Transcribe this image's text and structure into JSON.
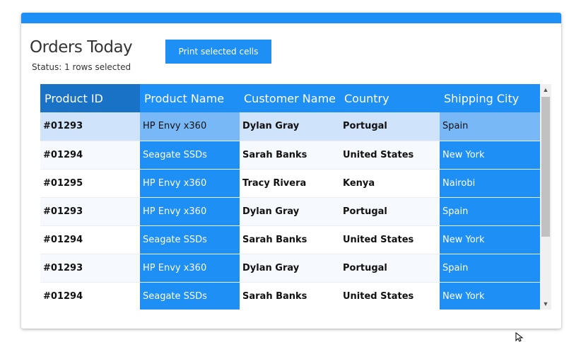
{
  "header": {
    "title": "Orders Today",
    "status": "Status: 1 rows selected",
    "print_label": "Print selected cells"
  },
  "grid": {
    "columns": [
      "Product ID",
      "Product Name",
      "Customer Name",
      "Country",
      "Shipping City"
    ],
    "rows": [
      {
        "id": "#01293",
        "product": "HP Envy x360",
        "customer": "Dylan Gray",
        "country": "Portugal",
        "city": "Spain"
      },
      {
        "id": "#01294",
        "product": "Seagate SSDs",
        "customer": "Sarah Banks",
        "country": "United States",
        "city": "New York"
      },
      {
        "id": "#01295",
        "product": "HP Envy x360",
        "customer": "Tracy Rivera",
        "country": "Kenya",
        "city": "Nairobi"
      },
      {
        "id": "#01293",
        "product": "HP Envy x360",
        "customer": "Dylan Gray",
        "country": "Portugal",
        "city": "Spain"
      },
      {
        "id": "#01294",
        "product": "Seagate SSDs",
        "customer": "Sarah Banks",
        "country": "United States",
        "city": "New York"
      },
      {
        "id": "#01293",
        "product": "HP Envy x360",
        "customer": "Dylan Gray",
        "country": "Portugal",
        "city": "Spain"
      },
      {
        "id": "#01294",
        "product": "Seagate SSDs",
        "customer": "Sarah Banks",
        "country": "United States",
        "city": "New York"
      }
    ],
    "selected_row": 0,
    "selected_columns": [
      "product",
      "city"
    ]
  },
  "icons": {
    "scroll_up": "chevron-up-icon",
    "scroll_down": "chevron-down-icon",
    "cursor": "mouse-cursor-icon"
  },
  "colors": {
    "accent": "#1e8ff5",
    "header_first": "#1a72c7",
    "row_selected": "#cfe4fb",
    "cell_selected_in_row": "#79b8f7"
  }
}
